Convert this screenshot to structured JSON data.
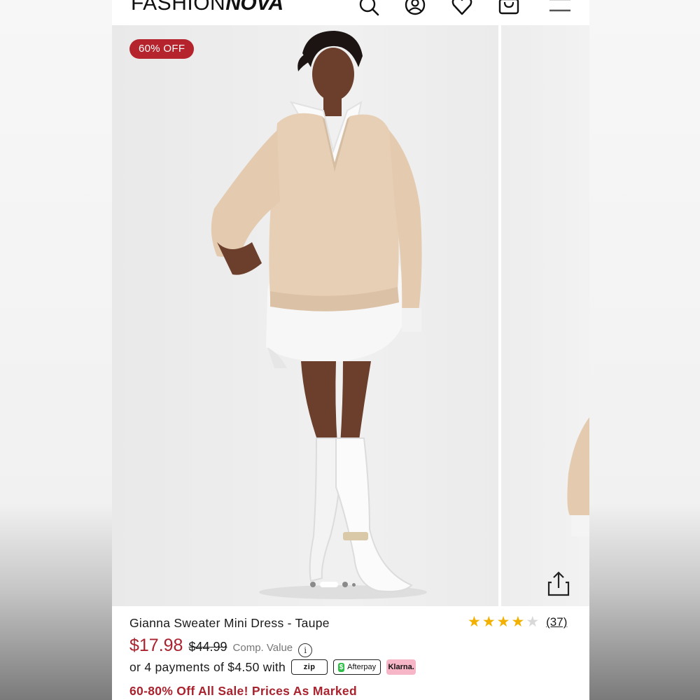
{
  "header": {
    "logo_thin": "FASHION",
    "logo_bold": "NOVA",
    "icons": [
      "search-icon",
      "account-icon",
      "wishlist-heart-icon",
      "shopping-bag-icon",
      "hamburger-menu-icon"
    ]
  },
  "gallery": {
    "badge": "60% OFF",
    "dots_count": 4,
    "active_dot": 1,
    "share_icon": "share-upload-icon"
  },
  "product": {
    "title": "Gianna Sweater Mini Dress - Taupe",
    "rating": 4,
    "rating_max": 5,
    "review_count": "(37)",
    "price": "$17.98",
    "original_price": "$44.99",
    "comp_value_label": "Comp. Value",
    "payment_text": "or 4 payments of $4.50 with",
    "payment_providers": {
      "zip": "zip",
      "afterpay": "Afterpay",
      "klarna": "Klarna."
    },
    "sale_banner": "60-80% Off All Sale! Prices As Marked"
  },
  "colors": {
    "accent_red": "#b5232d",
    "price_red": "#a8232e",
    "star_gold": "#f2b100"
  }
}
